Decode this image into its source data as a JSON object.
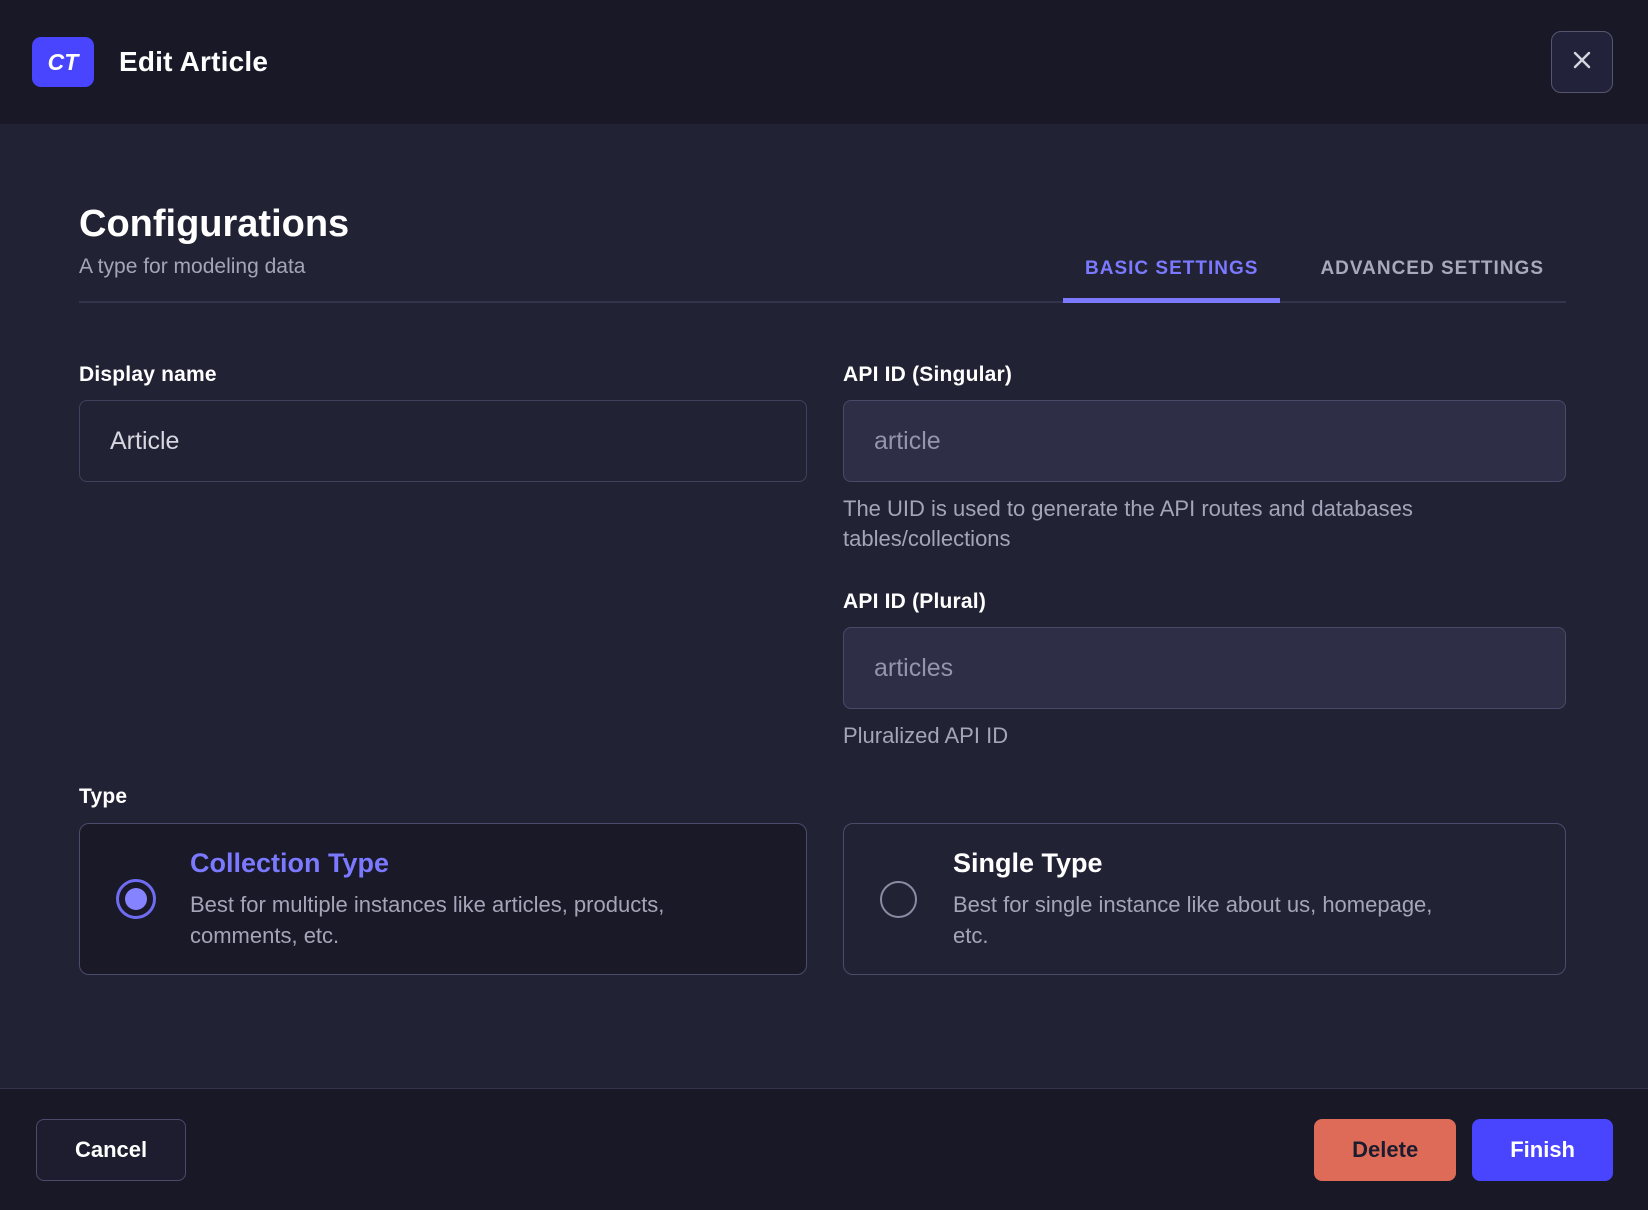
{
  "header": {
    "badge": "CT",
    "title": "Edit Article"
  },
  "config": {
    "title": "Configurations",
    "subtitle": "A type for modeling data"
  },
  "tabs": [
    {
      "label": "BASIC SETTINGS",
      "active": true
    },
    {
      "label": "ADVANCED SETTINGS",
      "active": false
    }
  ],
  "fields": {
    "display_name": {
      "label": "Display name",
      "value": "Article"
    },
    "api_id_singular": {
      "label": "API ID (Singular)",
      "value": "article",
      "help": "The UID is used to generate the API routes and databases\ntables/collections"
    },
    "api_id_plural": {
      "label": "API ID (Plural)",
      "value": "articles",
      "help": "Pluralized API ID"
    }
  },
  "type_section": {
    "label": "Type",
    "options": [
      {
        "title": "Collection Type",
        "description": "Best for multiple instances like articles, products,\ncomments, etc.",
        "selected": true
      },
      {
        "title": "Single Type",
        "description": "Best for single instance like about us, homepage,\netc.",
        "selected": false
      }
    ]
  },
  "footer": {
    "cancel": "Cancel",
    "delete": "Delete",
    "finish": "Finish"
  },
  "colors": {
    "primary": "#4945ff",
    "primary_light": "#7b79ff",
    "danger": "#de6b58",
    "header_bg": "#181826",
    "body_bg": "#222235"
  }
}
